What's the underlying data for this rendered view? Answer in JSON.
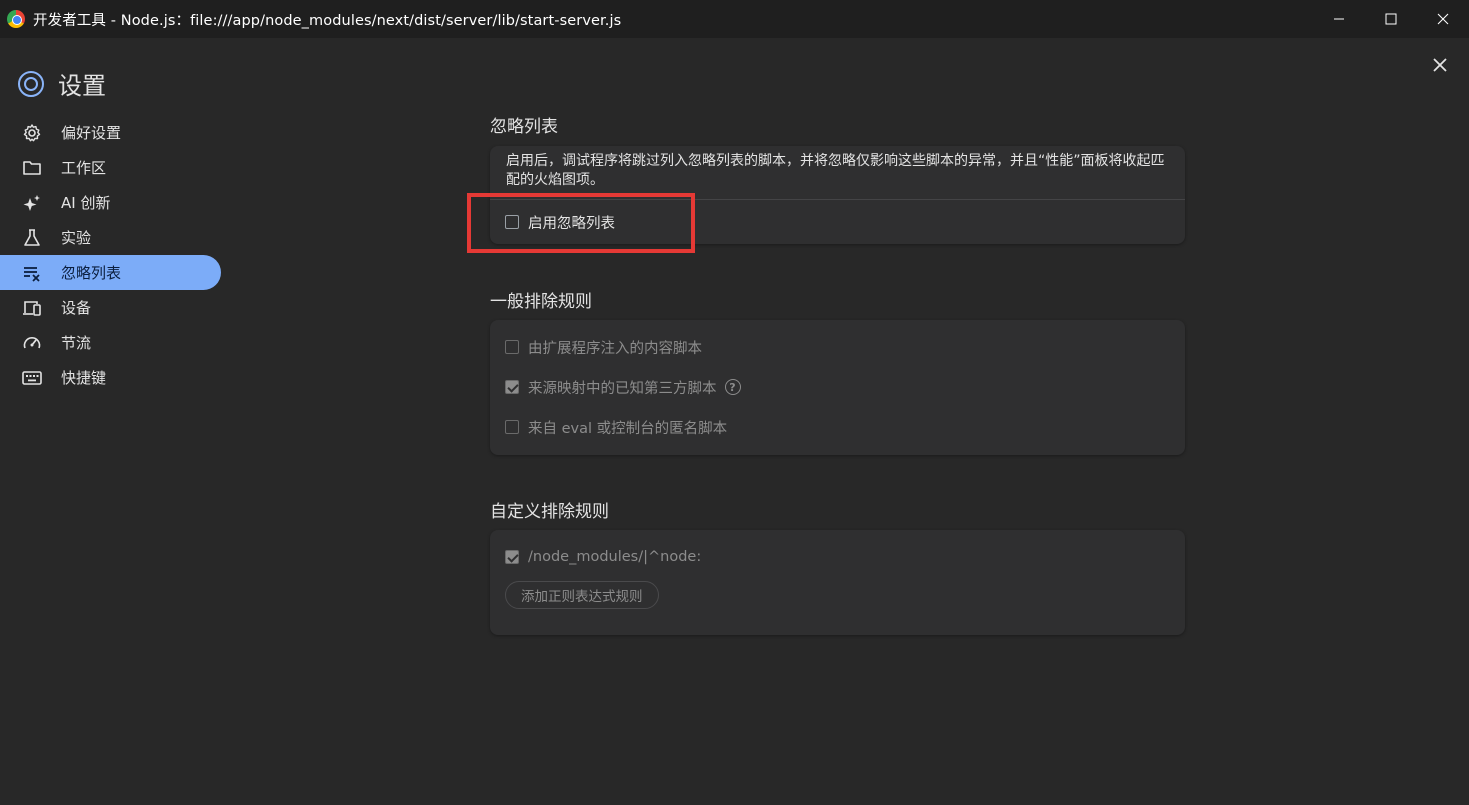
{
  "window": {
    "title": "开发者工具 - Node.js：file:///app/node_modules/next/dist/server/lib/start-server.js",
    "controls": [
      "minimize",
      "maximize",
      "close"
    ]
  },
  "sidebar": {
    "title": "设置",
    "items": [
      {
        "label": "偏好设置",
        "icon": "gear-icon",
        "active": false
      },
      {
        "label": "工作区",
        "icon": "folder-icon",
        "active": false
      },
      {
        "label": "AI 创新",
        "icon": "sparkle-icon",
        "active": false
      },
      {
        "label": "实验",
        "icon": "flask-icon",
        "active": false
      },
      {
        "label": "忽略列表",
        "icon": "ignore-list-icon",
        "active": true
      },
      {
        "label": "设备",
        "icon": "devices-icon",
        "active": false
      },
      {
        "label": "节流",
        "icon": "speedometer-icon",
        "active": false
      },
      {
        "label": "快捷键",
        "icon": "keyboard-icon",
        "active": false
      }
    ]
  },
  "ignore_list": {
    "title": "忽略列表",
    "description": "启用后，调试程序将跳过列入忽略列表的脚本，并将忽略仅影响这些脚本的异常，并且“性能”面板将收起匹配的火焰图项。",
    "enable_label": "启用忽略列表",
    "enable_checked": false
  },
  "general_rules": {
    "title": "一般排除规则",
    "items": [
      {
        "label": "由扩展程序注入的内容脚本",
        "checked": false
      },
      {
        "label": "来源映射中的已知第三方脚本",
        "checked": true,
        "help": "?"
      },
      {
        "label": "来自 eval 或控制台的匿名脚本",
        "checked": false
      }
    ]
  },
  "custom_rules": {
    "title": "自定义排除规则",
    "rules": [
      {
        "pattern": "/node_modules/|^node:",
        "checked": true
      }
    ],
    "add_button": "添加正则表达式规则"
  },
  "colors": {
    "background": "#282828",
    "titlebar": "#1f1f1f",
    "active_nav": "#7cacf8",
    "highlight": "#e53935"
  }
}
